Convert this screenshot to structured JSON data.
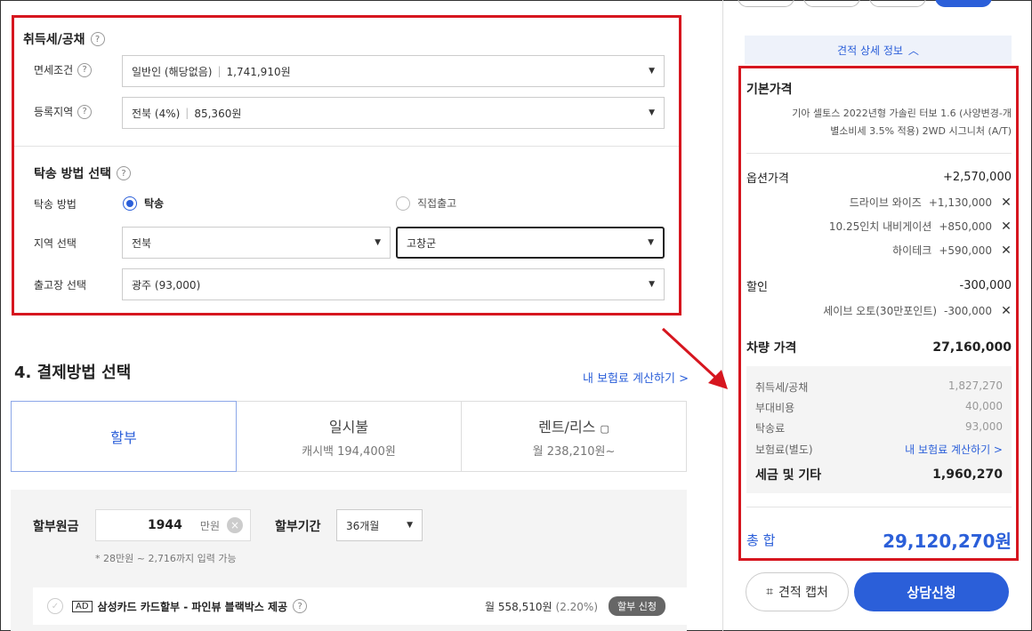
{
  "acquisition": {
    "title": "취득세/공채",
    "help": "?",
    "exempt_label": "면세조건",
    "exempt_value": "일반인 (해당없음)",
    "exempt_amount": "1,741,910원",
    "region_label": "등록지역",
    "region_value": "전북 (4%)",
    "region_amount": "85,360원"
  },
  "delivery": {
    "title": "탁송 방법 선택",
    "method_label": "탁송 방법",
    "option_delivery": "탁송",
    "option_direct": "직접출고",
    "area_label": "지역 선택",
    "area_province": "전북",
    "area_county": "고창군",
    "factory_label": "출고장 선택",
    "factory_value": "광주 (93,000)"
  },
  "payment": {
    "title": "4. 결제방법 선택",
    "insurance_link": "내 보험료 계산하기 >",
    "tabs": [
      {
        "label": "할부",
        "sub": ""
      },
      {
        "label": "일시불",
        "sub": "캐시백 194,400원"
      },
      {
        "label": "렌트/리스",
        "sub": "월 238,210원~"
      }
    ],
    "principal_label": "할부원금",
    "principal_value": "1944",
    "principal_unit": "만원",
    "period_label": "할부기간",
    "period_value": "36개월",
    "hint": "* 28만원 ~ 2,716까지 입력 가능",
    "card": {
      "ad": "AD",
      "title": "삼성카드 카드할부 - 파인뷰 블랙박스 제공",
      "price": "월 558,510원",
      "rate": "(2.20%)",
      "button": "할부 신청"
    }
  },
  "estimate": {
    "detail_toggle": "견적 상세 정보",
    "base_title": "기본가격",
    "base_desc_1": "기아 셀토스 2022년형 가솔린 터보 1.6 (사양변경-개",
    "base_desc_2": "별소비세 3.5% 적용) 2WD 시그니처 (A/T)",
    "options_label": "옵션가격",
    "options_total": "+2,570,000",
    "options": [
      {
        "name": "드라이브 와이즈",
        "price": "+1,130,000"
      },
      {
        "name": "10.25인치 내비게이션",
        "price": "+850,000"
      },
      {
        "name": "하이테크",
        "price": "+590,000"
      }
    ],
    "discount_label": "할인",
    "discount_total": "-300,000",
    "discounts": [
      {
        "name": "세이브 오토(30만포인트)",
        "price": "-300,000"
      }
    ],
    "car_price_label": "차량 가격",
    "car_price": "27,160,000",
    "taxes": [
      {
        "name": "취득세/공채",
        "value": "1,827,270"
      },
      {
        "name": "부대비용",
        "value": "40,000"
      },
      {
        "name": "탁송료",
        "value": "93,000"
      }
    ],
    "insurance_label": "보험료(별도)",
    "insurance_link": "내 보험료 계산하기 >",
    "tax_total_label": "세금 및 기타",
    "tax_total": "1,960,270",
    "grand_label": "총 합",
    "grand_total": "29,120,270원",
    "capture_button": "견적 캡처",
    "consult_button": "상담신청"
  }
}
